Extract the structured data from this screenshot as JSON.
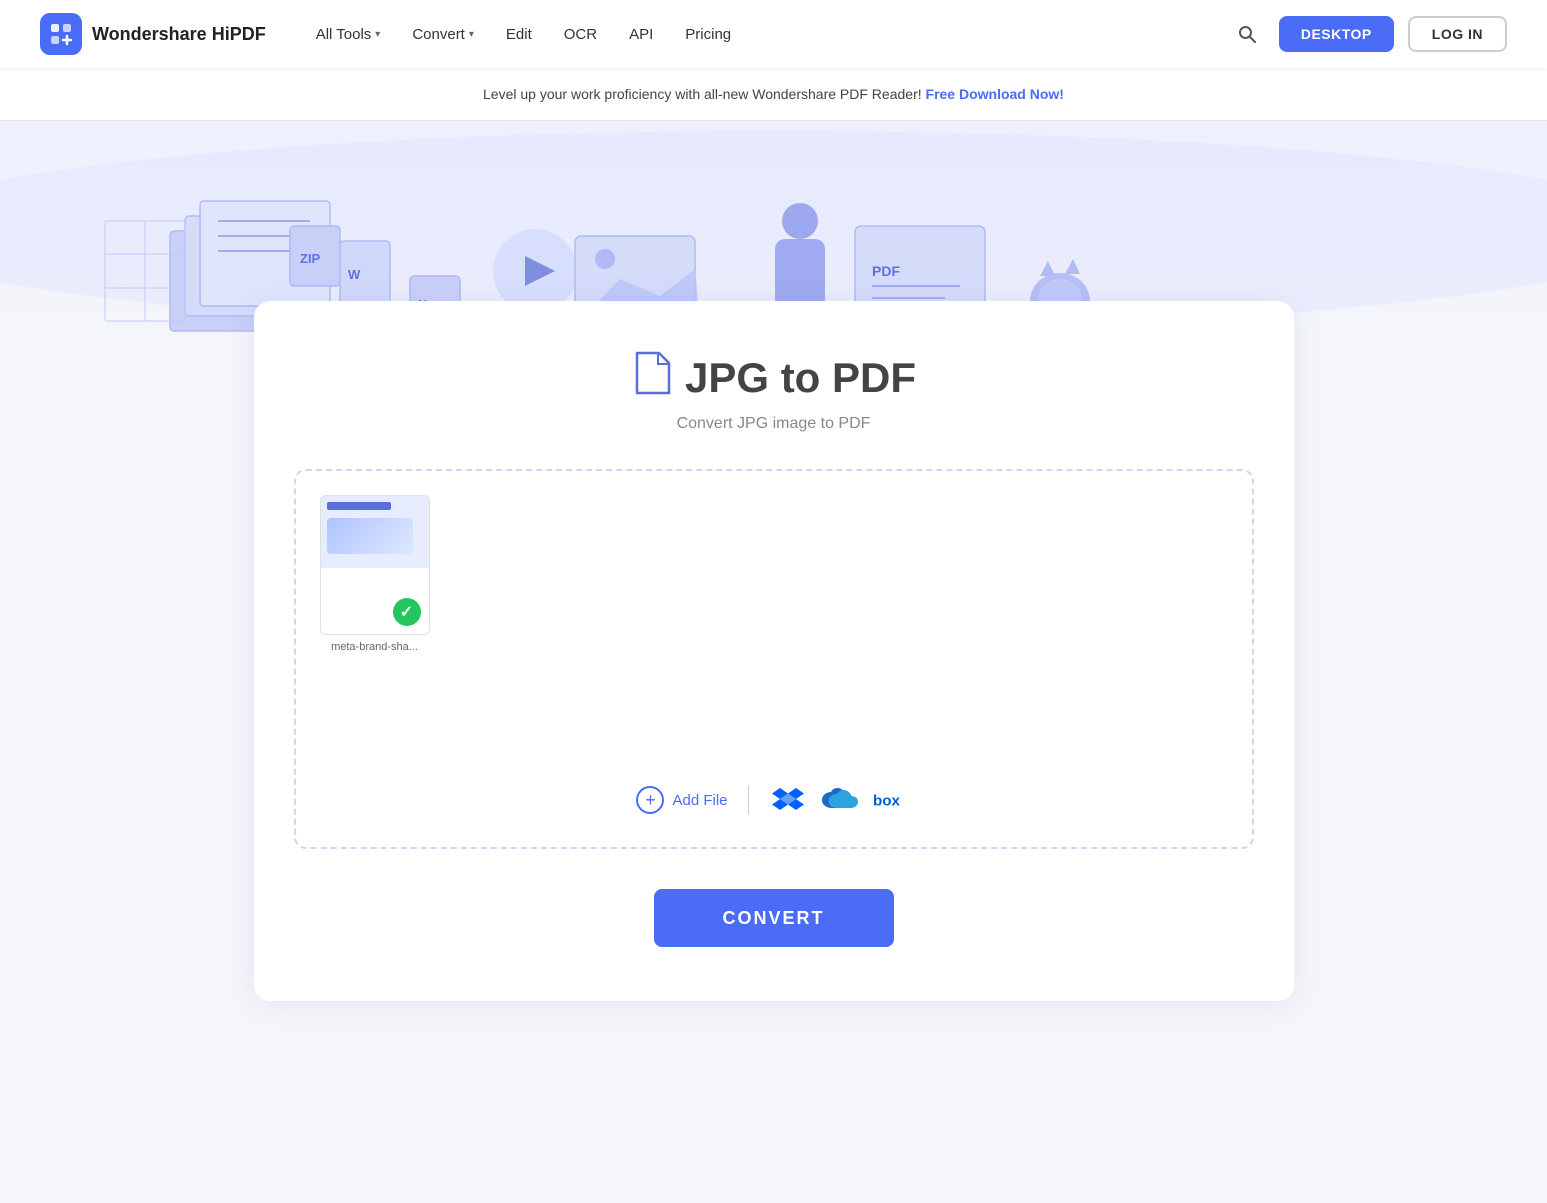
{
  "brand": {
    "name": "Wondershare HiPDF",
    "logo_alt": "HiPDF logo"
  },
  "nav": {
    "items": [
      {
        "label": "All Tools",
        "has_dropdown": true
      },
      {
        "label": "Convert",
        "has_dropdown": true
      },
      {
        "label": "Edit",
        "has_dropdown": false
      },
      {
        "label": "OCR",
        "has_dropdown": false
      },
      {
        "label": "API",
        "has_dropdown": false
      },
      {
        "label": "Pricing",
        "has_dropdown": false
      }
    ],
    "desktop_btn": "DESKTOP",
    "login_btn": "LOG IN"
  },
  "banner": {
    "text": "Level up your work proficiency with all-new Wondershare PDF Reader!",
    "link_text": "Free Download Now!"
  },
  "converter": {
    "title": "JPG to PDF",
    "subtitle": "Convert JPG image to PDF",
    "file": {
      "name": "meta-brand-sha...",
      "status": "success"
    },
    "add_file_label": "Add File",
    "cloud_providers": [
      "dropbox",
      "onedrive",
      "box"
    ],
    "convert_btn": "CONVERT"
  },
  "colors": {
    "primary": "#4A6CF7",
    "success": "#22c55e",
    "text_dark": "#333333",
    "text_muted": "#888888",
    "border": "#d0d4f5",
    "hero_bg": "#eef0ff"
  }
}
